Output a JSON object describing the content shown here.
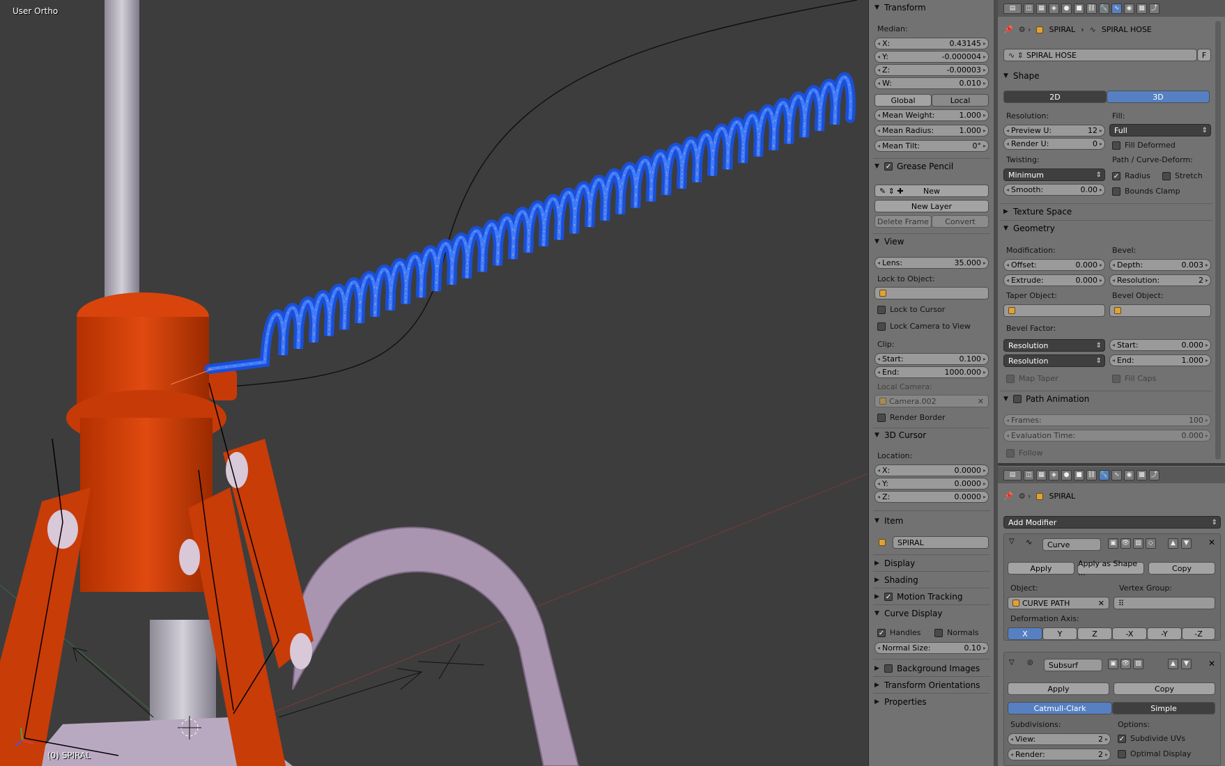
{
  "viewport": {
    "view_label": "User Ortho",
    "object_label": "(0) SPIRAL"
  },
  "npanel": {
    "transform": {
      "title": "Transform",
      "median_label": "Median:",
      "x_label": "X:",
      "x": "0.43145",
      "y_label": "Y:",
      "y": "-0.000004",
      "z_label": "Z:",
      "z": "-0.00003",
      "w_label": "W:",
      "w": "0.010",
      "global": "Global",
      "local": "Local",
      "mean_weight_label": "Mean Weight:",
      "mean_weight": "1.000",
      "mean_radius_label": "Mean Radius:",
      "mean_radius": "1.000",
      "mean_tilt_label": "Mean Tilt:",
      "mean_tilt": "0°"
    },
    "grease_pencil": {
      "title": "Grease Pencil",
      "new": "New",
      "new_layer": "New Layer",
      "delete_frame": "Delete Frame",
      "convert": "Convert"
    },
    "view": {
      "title": "View",
      "lens_label": "Lens:",
      "lens": "35.000",
      "lock_to_object": "Lock to Object:",
      "lock_to_cursor": "Lock to Cursor",
      "lock_camera": "Lock Camera to View",
      "clip": "Clip:",
      "start_label": "Start:",
      "start": "0.100",
      "end_label": "End:",
      "end": "1000.000",
      "local_camera": "Local Camera:",
      "camera": "Camera.002",
      "render_border": "Render Border"
    },
    "cursor": {
      "title": "3D Cursor",
      "location": "Location:",
      "x_label": "X:",
      "x": "0.0000",
      "y_label": "Y:",
      "y": "0.0000",
      "z_label": "Z:",
      "z": "0.0000"
    },
    "item": {
      "title": "Item",
      "name": "SPIRAL"
    },
    "collapsed": {
      "display": "Display",
      "shading": "Shading",
      "motion_tracking": "Motion Tracking"
    },
    "curve_display": {
      "title": "Curve Display",
      "handles": "Handles",
      "normals": "Normals",
      "normal_size_label": "Normal Size:",
      "normal_size": "0.10"
    },
    "bottom": {
      "background_images": "Background Images",
      "transform_orientations": "Transform Orientations",
      "properties": "Properties"
    }
  },
  "props_top": {
    "breadcrumb_object": "SPIRAL",
    "breadcrumb_data": "SPIRAL HOSE",
    "datablock": "SPIRAL HOSE",
    "fake_user": "F",
    "shape": {
      "title": "Shape",
      "btn_2d": "2D",
      "btn_3d": "3D",
      "resolution": "Resolution:",
      "fill": "Fill:",
      "preview_u_label": "Preview U:",
      "preview_u": "12",
      "render_u_label": "Render U:",
      "render_u": "0",
      "fill_value": "Full",
      "fill_deformed": "Fill Deformed",
      "twisting": "Twisting:",
      "path_curve_deform": "Path / Curve-Deform:",
      "twist_value": "Minimum",
      "radius": "Radius",
      "stretch": "Stretch",
      "smooth_label": "Smooth:",
      "smooth": "0.00",
      "bounds_clamp": "Bounds Clamp"
    },
    "texture_space": "Texture Space",
    "geometry": {
      "title": "Geometry",
      "modification": "Modification:",
      "bevel": "Bevel:",
      "offset_label": "Offset:",
      "offset": "0.000",
      "depth_label": "Depth:",
      "depth": "0.003",
      "extrude_label": "Extrude:",
      "extrude": "0.000",
      "resolution_label": "Resolution:",
      "resolution": "2",
      "taper_object": "Taper Object:",
      "bevel_object": "Bevel Object:",
      "bevel_factor": "Bevel Factor:",
      "bf_mode1": "Resolution",
      "bf_start_label": "Start:",
      "bf_start": "0.000",
      "bf_mode2": "Resolution",
      "bf_end_label": "End:",
      "bf_end": "1.000",
      "map_taper": "Map Taper",
      "fill_caps": "Fill Caps"
    },
    "path_animation": {
      "title": "Path Animation",
      "frames_label": "Frames:",
      "frames": "100",
      "eval_label": "Evaluation Time:",
      "eval": "0.000",
      "follow": "Follow"
    }
  },
  "props_bottom": {
    "breadcrumb_object": "SPIRAL",
    "add_modifier": "Add Modifier",
    "curve_mod": {
      "name": "Curve",
      "apply": "Apply",
      "apply_shape": "Apply as Shape ...",
      "copy": "Copy",
      "object_label": "Object:",
      "vertex_group_label": "Vertex Group:",
      "object": "CURVE PATH",
      "deformation_axis": "Deformation Axis:",
      "axes": [
        "X",
        "Y",
        "Z",
        "-X",
        "-Y",
        "-Z"
      ]
    },
    "subsurf_mod": {
      "name": "Subsurf",
      "apply": "Apply",
      "copy": "Copy",
      "catmull": "Catmull-Clark",
      "simple": "Simple",
      "subdivisions": "Subdivisions:",
      "options": "Options:",
      "view_label": "View:",
      "view": "2",
      "render_label": "Render:",
      "render": "2",
      "subdivide_uvs": "Subdivide UVs",
      "optimal_display": "Optimal Display"
    }
  }
}
